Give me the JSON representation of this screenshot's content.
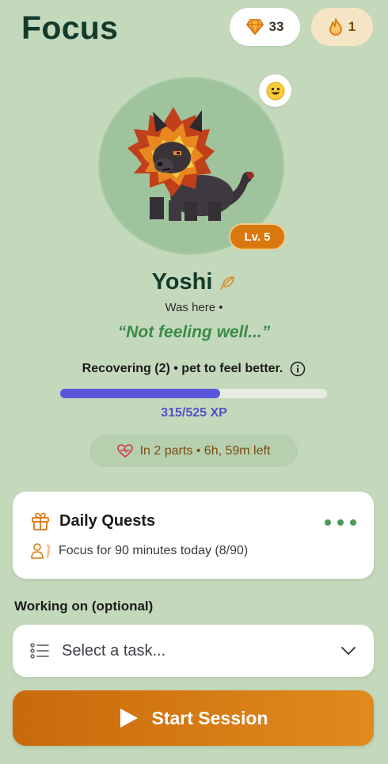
{
  "header": {
    "title": "Focus",
    "gems": "33",
    "streak": "1"
  },
  "pet": {
    "name": "Yoshi",
    "level": "Lv. 5",
    "status": "Was here •",
    "quote": "“Not feeling well...”",
    "mood_icon": "happy-face-icon",
    "recovery_text": "Recovering (2) • pet to feel better.",
    "xp_text": "315/525 XP",
    "xp_current": 315,
    "xp_max": 525,
    "timer_text": "In 2 parts • 6h, 59m left"
  },
  "quests": {
    "title": "Daily Quests",
    "item": "Focus for 90 minutes today (8/90)"
  },
  "task": {
    "label": "Working on (optional)",
    "placeholder": "Select a task..."
  },
  "actions": {
    "start_label": "Start Session"
  },
  "colors": {
    "background": "#c4d9bc",
    "accent_orange": "#d9780e",
    "xp_fill": "#5a56dc",
    "title_green": "#143a2a",
    "quote_green": "#3a8a48"
  }
}
